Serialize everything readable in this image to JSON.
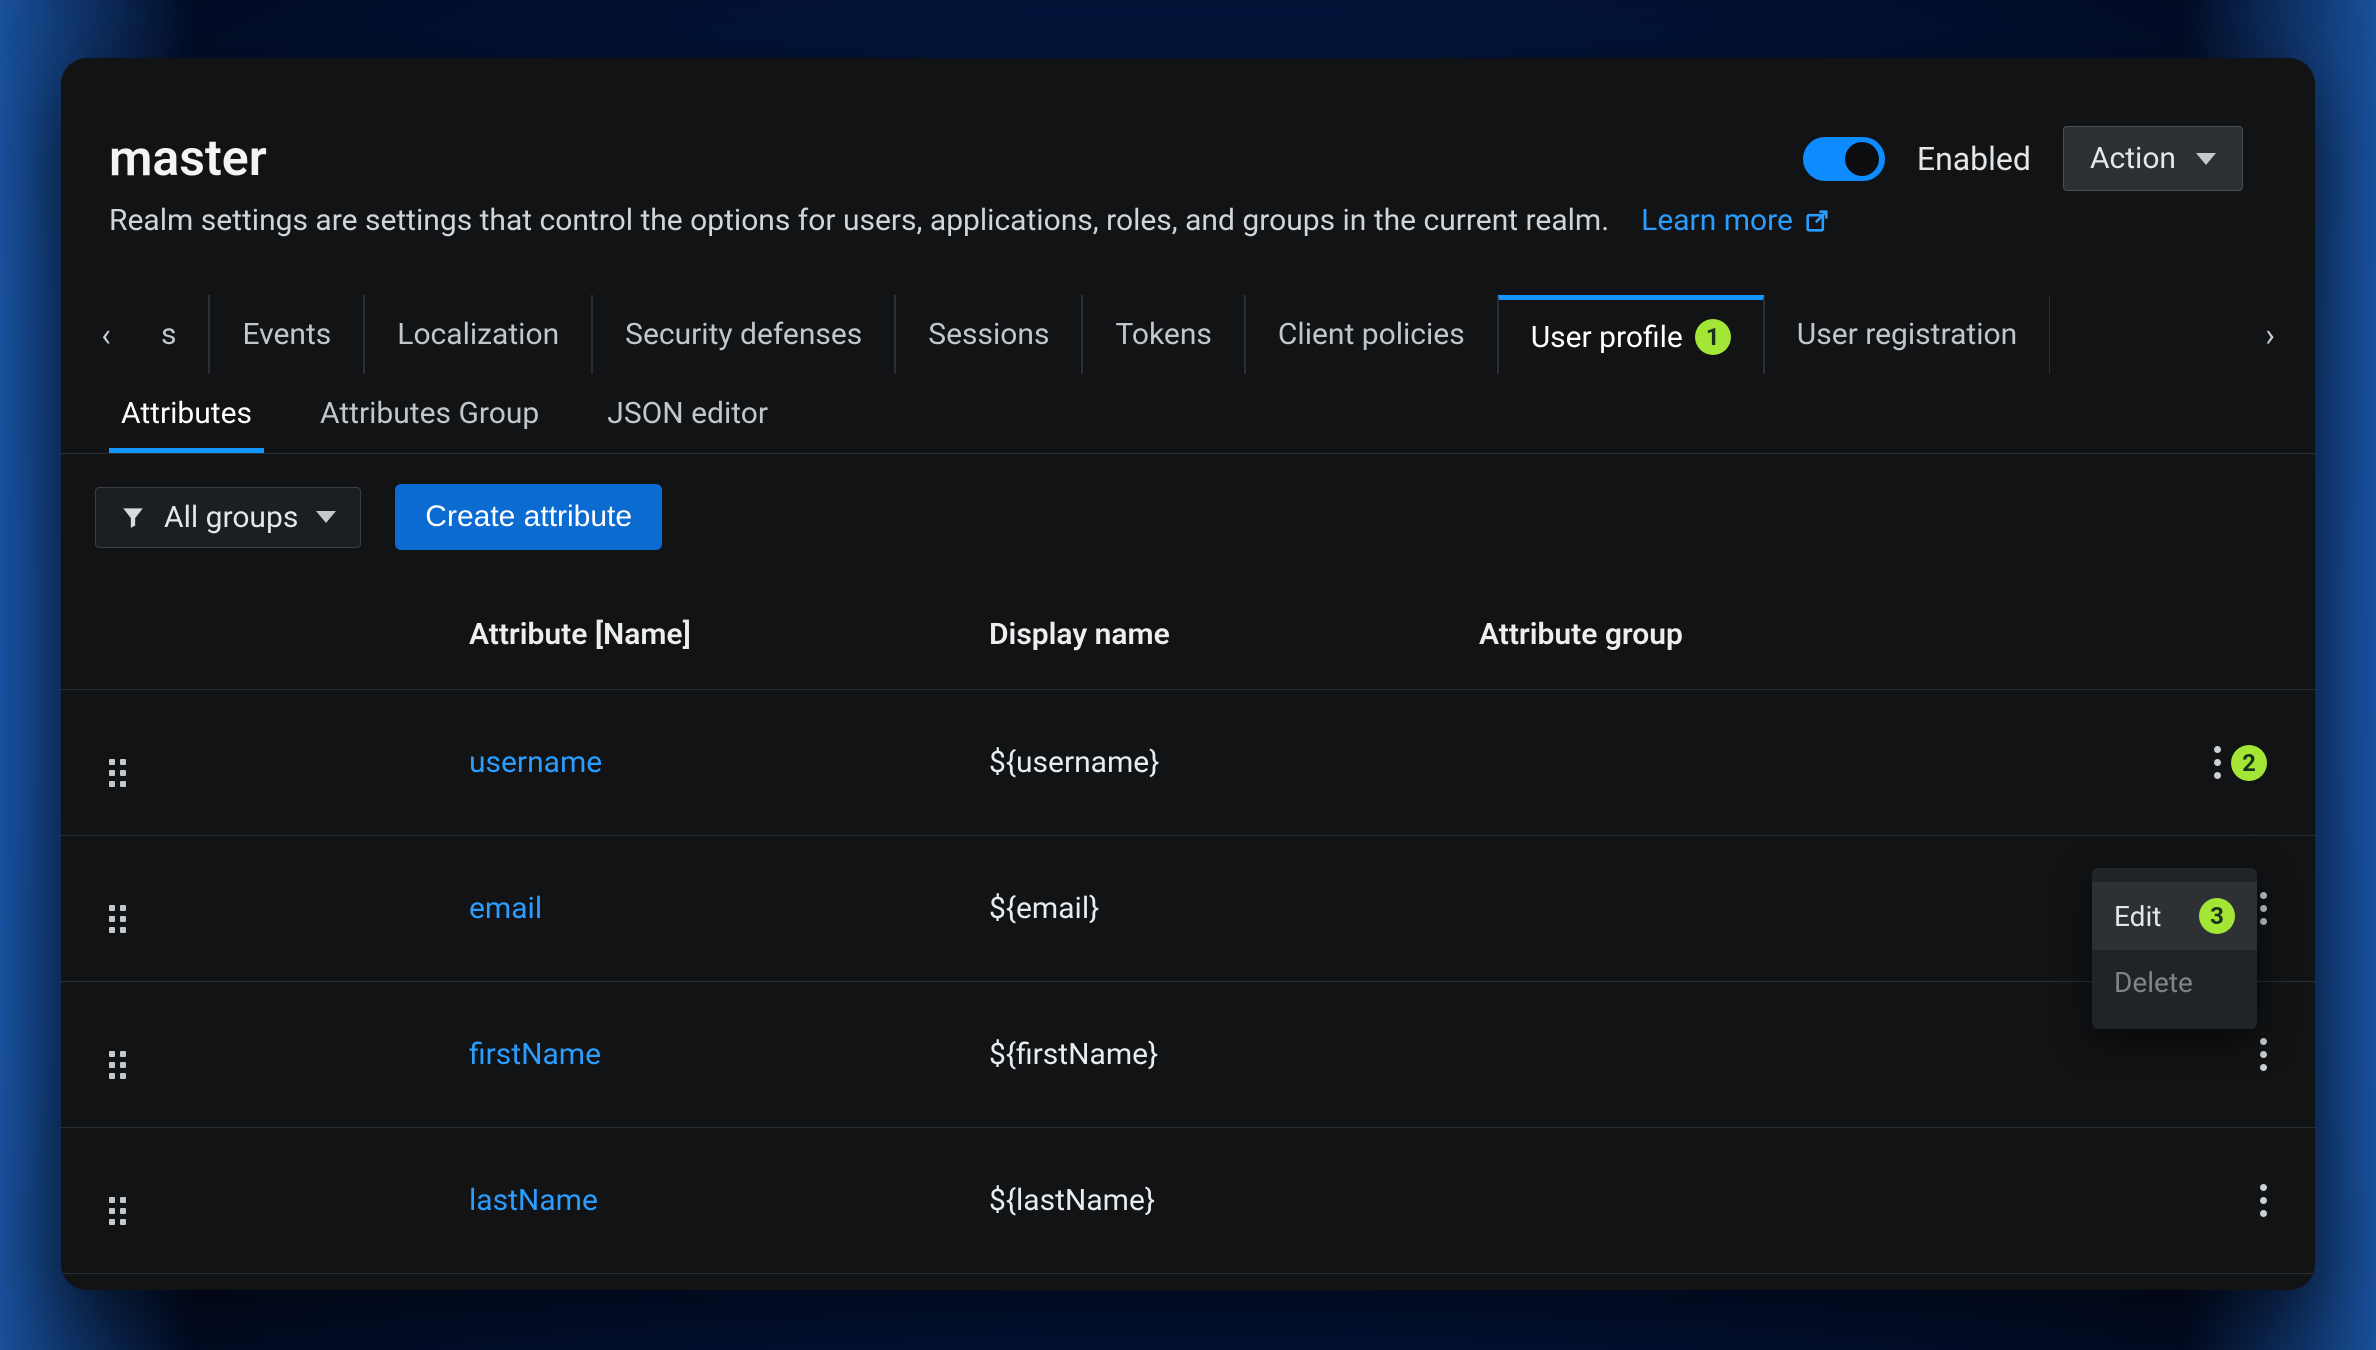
{
  "header": {
    "title": "master",
    "description": "Realm settings are settings that control the options for users, applications, roles, and groups in the current realm.",
    "learnMore": "Learn more",
    "enabledLabel": "Enabled",
    "enabled": true,
    "actionLabel": "Action"
  },
  "tabs": {
    "truncatedPrefix": "s",
    "items": [
      {
        "label": "Events"
      },
      {
        "label": "Localization"
      },
      {
        "label": "Security defenses"
      },
      {
        "label": "Sessions"
      },
      {
        "label": "Tokens"
      },
      {
        "label": "Client policies"
      },
      {
        "label": "User profile",
        "active": true,
        "badge": "1"
      },
      {
        "label": "User registration"
      }
    ]
  },
  "subtabs": [
    {
      "label": "Attributes",
      "active": true
    },
    {
      "label": "Attributes Group"
    },
    {
      "label": "JSON editor"
    }
  ],
  "toolbar": {
    "filterLabel": "All groups",
    "createLabel": "Create attribute"
  },
  "table": {
    "headers": {
      "attribute": "Attribute [Name]",
      "displayName": "Display name",
      "group": "Attribute group"
    },
    "rows": [
      {
        "name": "username",
        "display": "${username}",
        "group": "",
        "badge": "2"
      },
      {
        "name": "email",
        "display": "${email}",
        "group": ""
      },
      {
        "name": "firstName",
        "display": "${firstName}",
        "group": ""
      },
      {
        "name": "lastName",
        "display": "${lastName}",
        "group": ""
      }
    ]
  },
  "popup": {
    "editLabel": "Edit",
    "editBadge": "3",
    "deleteLabel": "Delete"
  }
}
